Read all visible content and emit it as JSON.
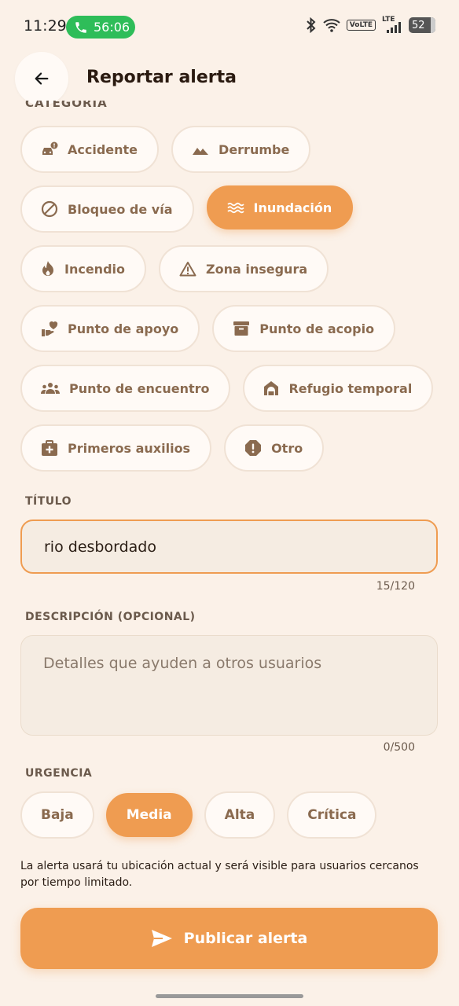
{
  "status_bar": {
    "time": "11:29",
    "call_timer": "56:06",
    "volte": "VoLTE",
    "lte": "LTE",
    "battery": "52"
  },
  "header": {
    "title": "Reportar alerta",
    "category_label": "CATEGORÍA"
  },
  "categories": [
    {
      "label": "Accidente",
      "icon": "car-crash-icon"
    },
    {
      "label": "Derrumbe",
      "icon": "mountain-icon"
    },
    {
      "label": "Bloqueo de vía",
      "icon": "block-icon"
    },
    {
      "label": "Inundación",
      "icon": "water-icon",
      "selected": true
    },
    {
      "label": "Incendio",
      "icon": "fire-icon"
    },
    {
      "label": "Zona insegura",
      "icon": "warning-icon"
    },
    {
      "label": "Punto de apoyo",
      "icon": "helping-hand-icon"
    },
    {
      "label": "Punto de acopio",
      "icon": "archive-box-icon"
    },
    {
      "label": "Punto de encuentro",
      "icon": "group-icon"
    },
    {
      "label": "Refugio temporal",
      "icon": "shelter-icon"
    },
    {
      "label": "Primeros auxilios",
      "icon": "first-aid-icon"
    },
    {
      "label": "Otro",
      "icon": "alert-octagon-icon"
    }
  ],
  "title_field": {
    "label": "TÍTULO",
    "value": "rio desbordado",
    "counter": "15/120"
  },
  "description_field": {
    "label": "DESCRIPCIÓN (OPCIONAL)",
    "placeholder": "Detalles que ayuden a otros usuarios",
    "counter": "0/500"
  },
  "urgency": {
    "label": "URGENCIA",
    "options": [
      "Baja",
      "Media",
      "Alta",
      "Crítica"
    ],
    "selected": "Media"
  },
  "note": "La alerta usará tu ubicación actual y será visible para usuarios cercanos por tiempo limitado.",
  "publish_button": "Publicar alerta",
  "colors": {
    "accent": "#ef9c51",
    "background": "#fbf1e8",
    "chip_text": "#8a6a4f"
  }
}
